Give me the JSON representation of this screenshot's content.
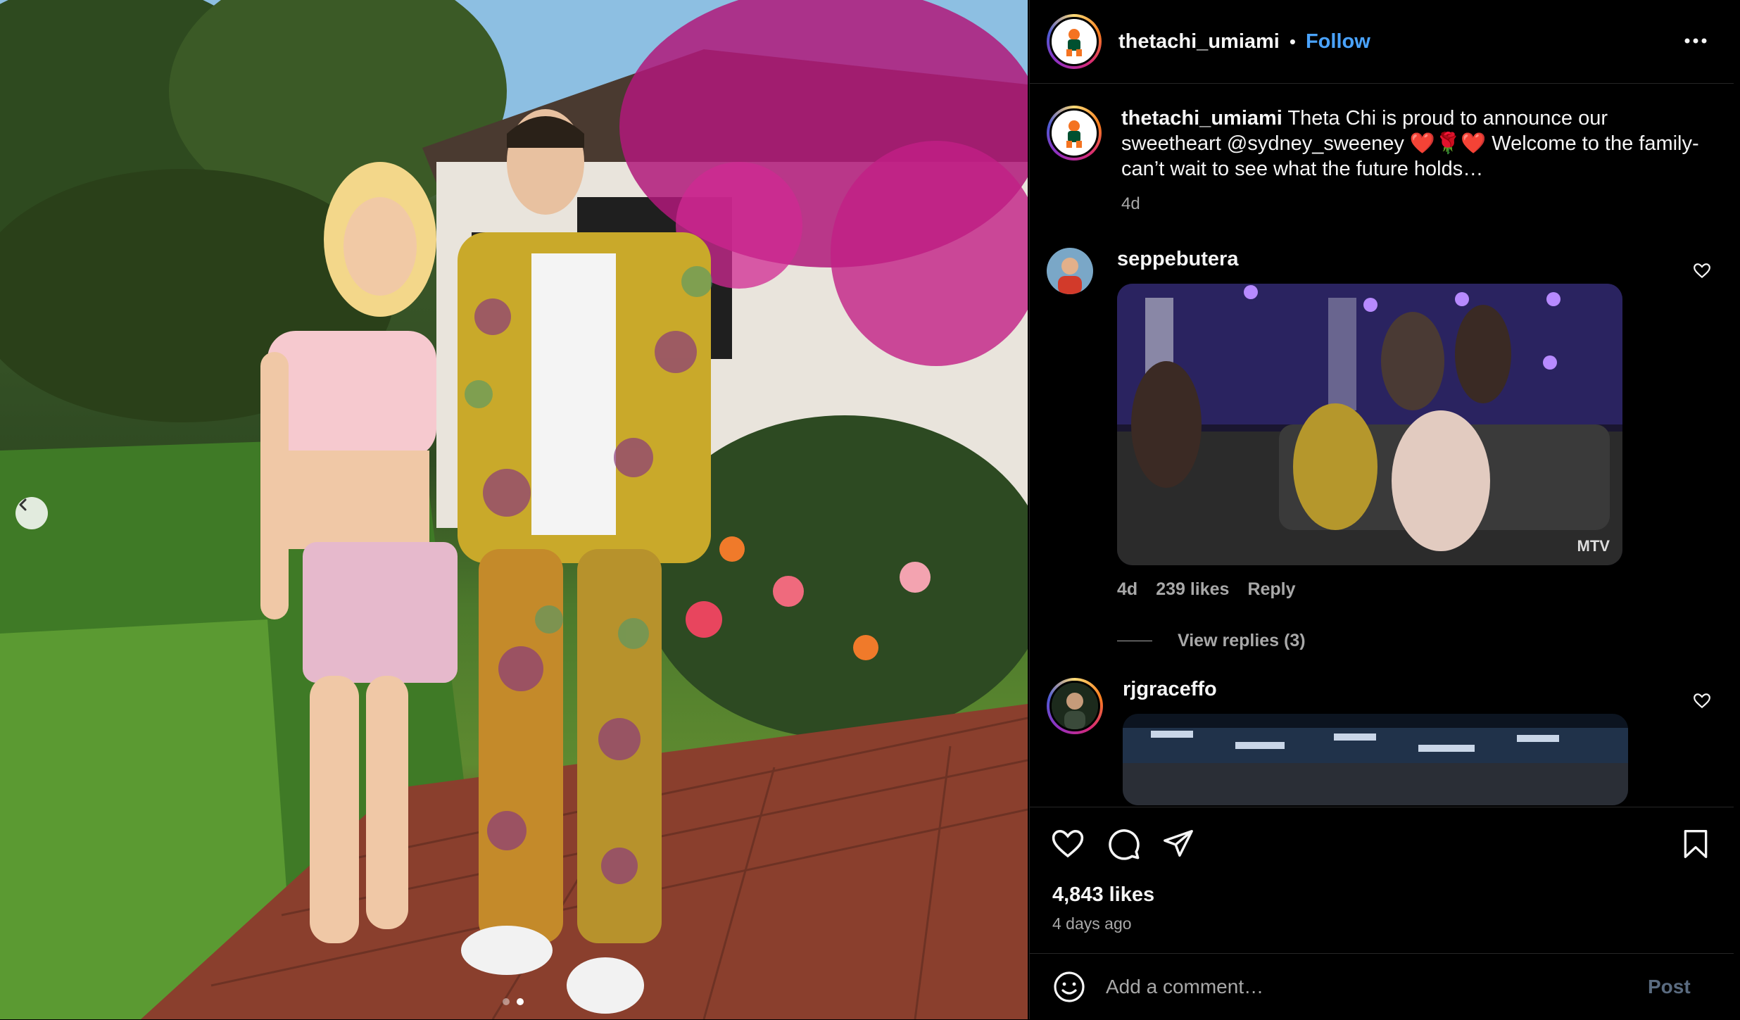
{
  "post": {
    "username": "thetachi_umiami",
    "separator": "•",
    "follow_label": "Follow",
    "carousel_dots": 2,
    "active_dot": 1
  },
  "caption": {
    "username": "thetachi_umiami",
    "text": "Theta Chi is proud to announce our sweetheart @sydney_sweeney ❤️🌹❤️ Welcome to the family- can’t wait to see what the future holds…",
    "time": "4d"
  },
  "comments": [
    {
      "username": "seppebutera",
      "time": "4d",
      "likes": "239 likes",
      "reply_label": "Reply",
      "view_replies": "View replies (3)",
      "gif_badge": "MTV"
    },
    {
      "username": "rjgraceffo"
    }
  ],
  "footer": {
    "likes": "4,843 likes",
    "ago": "4 days ago",
    "comment_placeholder": "Add a comment…",
    "post_label": "Post"
  },
  "icons": {
    "heart": "heart-icon",
    "comment": "comment-icon",
    "share": "share-icon",
    "save": "bookmark-icon",
    "more": "more-icon",
    "emoji": "emoji-icon"
  }
}
